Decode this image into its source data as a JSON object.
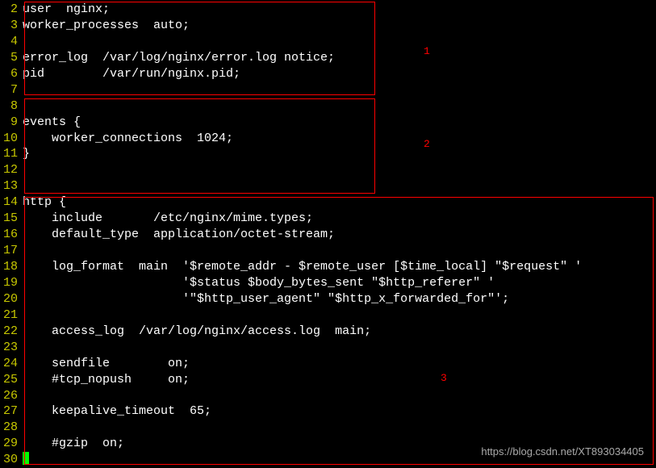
{
  "labels": {
    "box1": "1",
    "box2": "2",
    "box3": "3"
  },
  "watermark": "https://blog.csdn.net/XT893034405",
  "lines": [
    {
      "n": "2",
      "t": "user  nginx;"
    },
    {
      "n": "3",
      "t": "worker_processes  auto;"
    },
    {
      "n": "4",
      "t": ""
    },
    {
      "n": "5",
      "t": "error_log  /var/log/nginx/error.log notice;"
    },
    {
      "n": "6",
      "t": "pid        /var/run/nginx.pid;"
    },
    {
      "n": "7",
      "t": ""
    },
    {
      "n": "8",
      "t": ""
    },
    {
      "n": "9",
      "t": "events {"
    },
    {
      "n": "10",
      "t": "    worker_connections  1024;"
    },
    {
      "n": "11",
      "t": "}"
    },
    {
      "n": "12",
      "t": ""
    },
    {
      "n": "13",
      "t": ""
    },
    {
      "n": "14",
      "t": "http {"
    },
    {
      "n": "15",
      "t": "    include       /etc/nginx/mime.types;"
    },
    {
      "n": "16",
      "t": "    default_type  application/octet-stream;"
    },
    {
      "n": "17",
      "t": ""
    },
    {
      "n": "18",
      "t": "    log_format  main  '$remote_addr - $remote_user [$time_local] \"$request\" '"
    },
    {
      "n": "19",
      "t": "                      '$status $body_bytes_sent \"$http_referer\" '"
    },
    {
      "n": "20",
      "t": "                      '\"$http_user_agent\" \"$http_x_forwarded_for\"';"
    },
    {
      "n": "21",
      "t": ""
    },
    {
      "n": "22",
      "t": "    access_log  /var/log/nginx/access.log  main;"
    },
    {
      "n": "23",
      "t": ""
    },
    {
      "n": "24",
      "t": "    sendfile        on;"
    },
    {
      "n": "25",
      "t": "    #tcp_nopush     on;"
    },
    {
      "n": "26",
      "t": ""
    },
    {
      "n": "27",
      "t": "    keepalive_timeout  65;"
    },
    {
      "n": "28",
      "t": ""
    },
    {
      "n": "29",
      "t": "    #gzip  on;"
    },
    {
      "n": "30",
      "t": ""
    }
  ]
}
